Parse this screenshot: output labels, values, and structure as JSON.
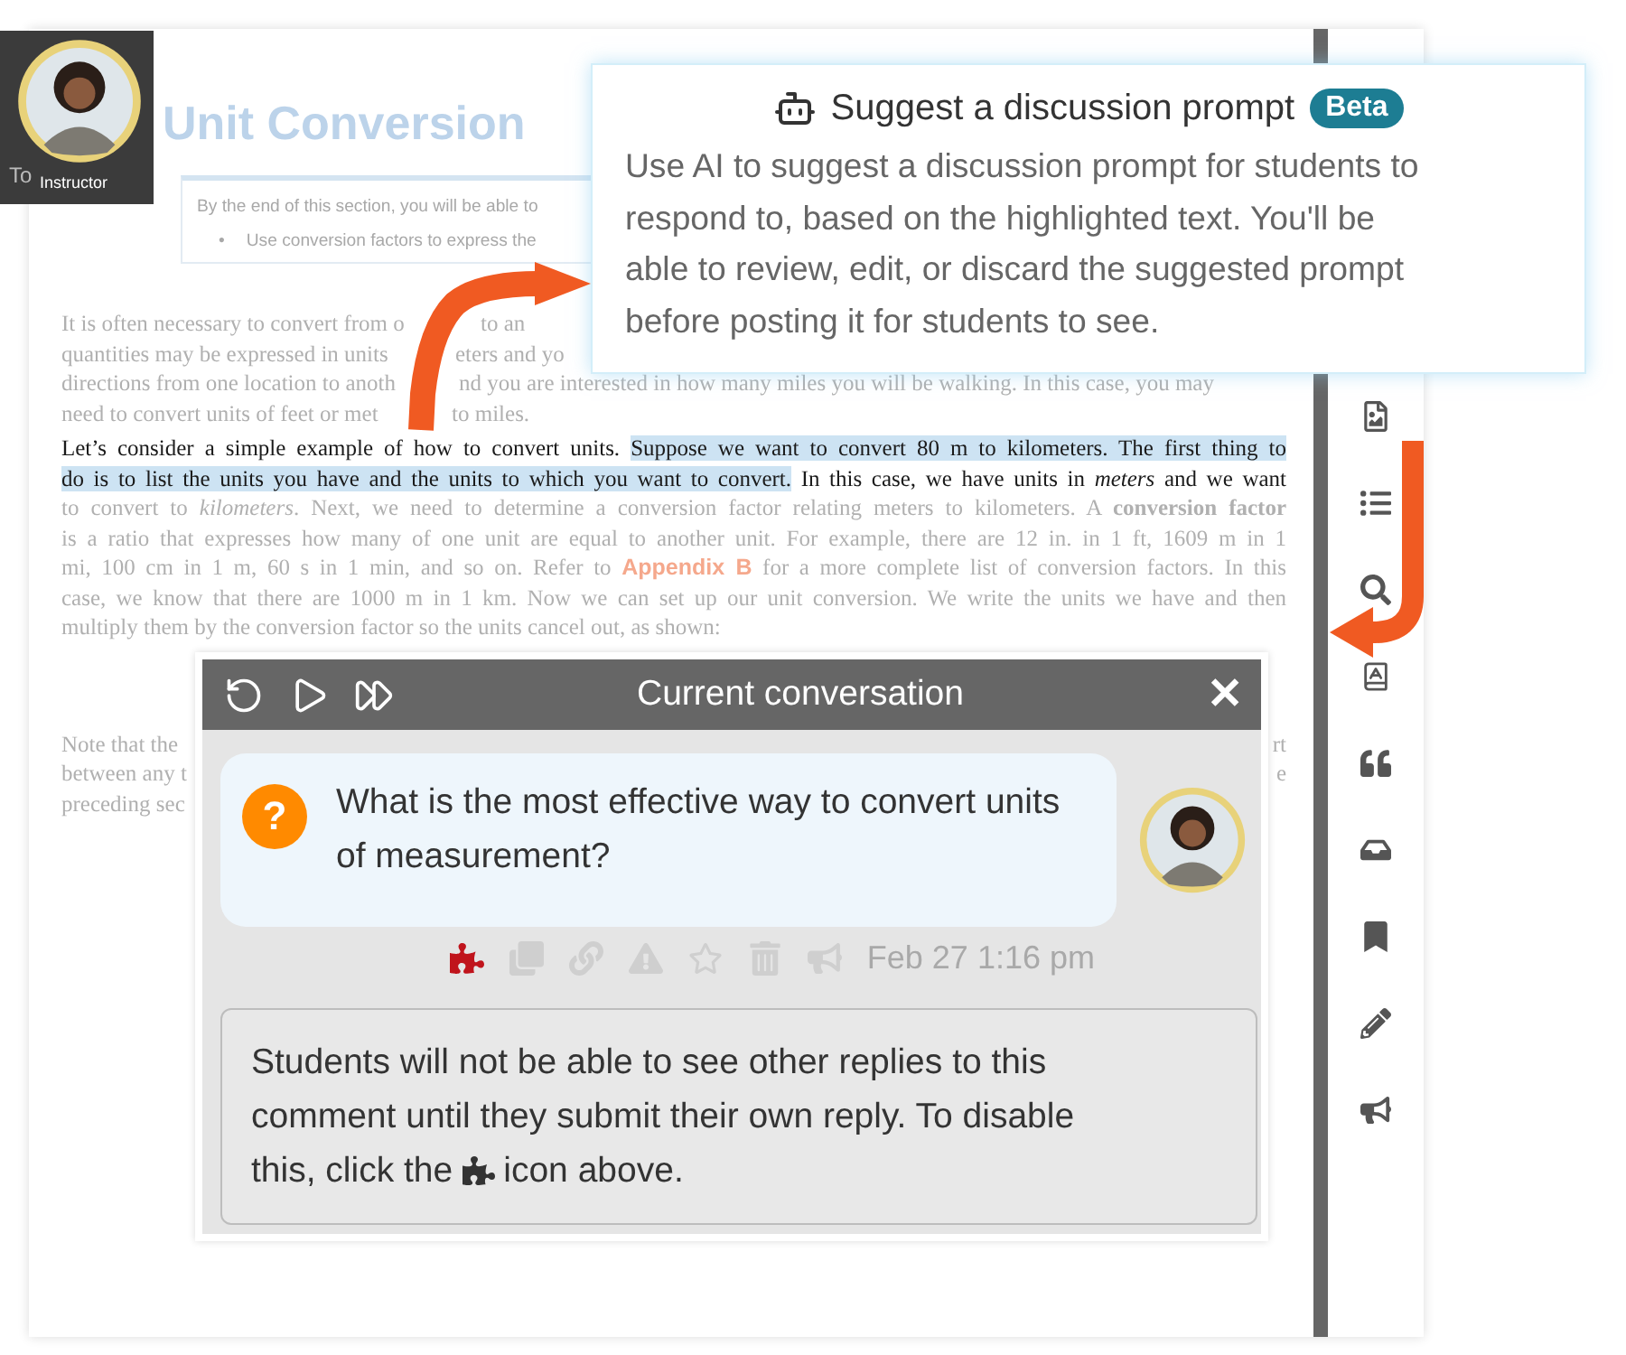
{
  "instructor": {
    "label": "Instructor",
    "behind_text": "To"
  },
  "document": {
    "title": "Unit Conversion",
    "objectives": {
      "intro": "By the end of this section, you will be able to",
      "bullets": [
        {
          "marker": "•",
          "text": "Use conversion factors to express the"
        }
      ]
    },
    "paragraph_1": [
      {
        "left": "It is often necessary to convert from o",
        "right": "to an"
      },
      {
        "left": "quantities may be expressed in units",
        "right": "eters and yo"
      },
      {
        "left": "directions from one location to anoth",
        "right": "nd you are interested in how many miles you will be walking. In this case, you may"
      },
      {
        "left": "need to convert units of feet or met",
        "right": "to miles."
      }
    ],
    "paragraph_2": [
      {
        "dim": false,
        "segments": [
          {
            "kind": "plain",
            "text": "Let’s consider a simple example of how to convert units. "
          },
          {
            "kind": "highlight",
            "text": "Suppose we want to convert 80 m to kilometers. The first thing to"
          }
        ]
      },
      {
        "dim": false,
        "segments": [
          {
            "kind": "highlight",
            "text": "do is to list the units you have and the units to which you want to convert."
          },
          {
            "kind": "plain",
            "text": " In this case, we have units in "
          },
          {
            "kind": "italic",
            "text": "meters"
          },
          {
            "kind": "plain",
            "text": " and we want"
          }
        ]
      },
      {
        "dim": true,
        "segments": [
          {
            "kind": "plain",
            "text": "to convert to "
          },
          {
            "kind": "italic",
            "text": "kilometers"
          },
          {
            "kind": "plain",
            "text": ". Next, we need to determine a conversion factor relating meters to kilometers. A "
          },
          {
            "kind": "bold",
            "text": "conversion factor"
          }
        ]
      },
      {
        "dim": true,
        "segments": [
          {
            "kind": "plain",
            "text": "is a ratio that expresses how many of one unit are equal to another unit. For example, there are 12 in. in 1 ft, 1609 m in 1"
          }
        ]
      },
      {
        "dim": true,
        "segments": [
          {
            "kind": "plain",
            "text": "mi, 100 cm in 1 m, 60 s in 1 min, and so on. Refer to "
          },
          {
            "kind": "link",
            "text": "Appendix B"
          },
          {
            "kind": "plain",
            "text": " for a more complete list of conversion factors. In this"
          }
        ]
      },
      {
        "dim": true,
        "segments": [
          {
            "kind": "plain",
            "text": "case, we know that there are 1000 m in 1 km. Now we can set up our unit conversion. We write the units we have and then"
          }
        ]
      },
      {
        "dim": true,
        "segments": [
          {
            "kind": "plain",
            "text": "multiply them by the conversion factor so the units cancel out, as shown:"
          }
        ]
      }
    ],
    "paragraph_3": [
      {
        "left": "Note that the",
        "right": "rt"
      },
      {
        "left": "between any t",
        "right": "e"
      },
      {
        "left": "preceding sec"
      }
    ]
  },
  "suggest_popup": {
    "title": "Suggest a discussion prompt",
    "badge": "Beta",
    "body": "Use AI to suggest a discussion prompt for students to respond to, based on the highlighted text. You'll be able to review, edit, or discard the suggested prompt before posting it for students to see."
  },
  "conversation": {
    "title": "Current conversation",
    "close": "✕",
    "comment": {
      "text": "What is the most effective way to convert units of measurement?",
      "badge": "?",
      "restricted": true,
      "timestamp": "Feb 27 1:16 pm"
    },
    "notice": {
      "lines": [
        "Students will not be able to see other replies to this",
        "comment until they submit their own reply. To disable"
      ],
      "before_icon": "this, click the",
      "after_icon": "icon above."
    }
  }
}
